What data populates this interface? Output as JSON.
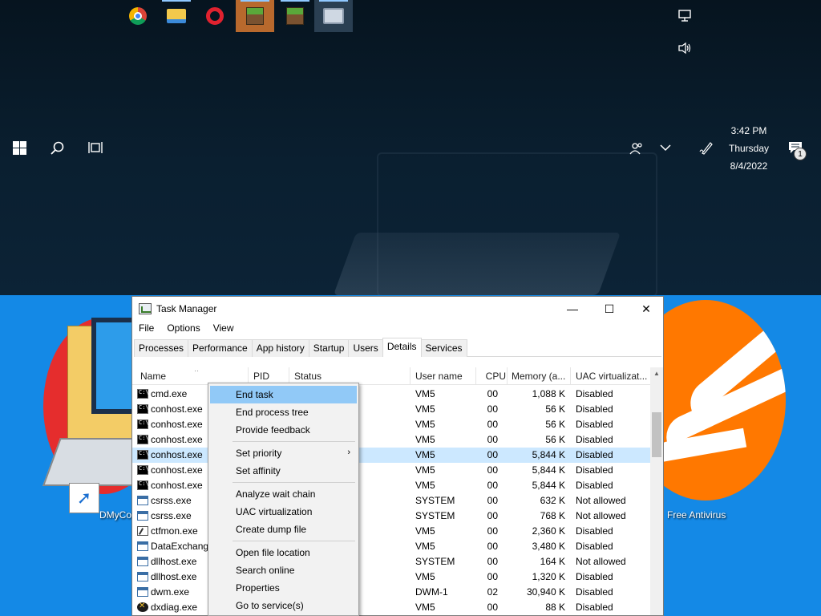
{
  "taskbar": {
    "apps": [
      {
        "name": "chrome-icon",
        "label": "Google Chrome"
      },
      {
        "name": "file-explorer-icon",
        "label": "File Explorer"
      },
      {
        "name": "opera-icon",
        "label": "Opera"
      },
      {
        "name": "minecraft-icon",
        "label": "Minecraft"
      },
      {
        "name": "minecraft-icon-2",
        "label": "Minecraft"
      },
      {
        "name": "dxdiag-window-icon",
        "label": "DirectX Diagnostic Tool"
      }
    ],
    "clock": {
      "time": "3:42 PM",
      "day": "Thursday",
      "date": "8/4/2022"
    },
    "notification_count": "1",
    "icons": {
      "start": "windows-start-icon",
      "search": "search-icon",
      "task_view": "task-view-icon",
      "people": "people-icon",
      "show_hidden": "chevron-down-icon",
      "pen": "pen-icon",
      "network": "network-icon",
      "volume": "volume-icon",
      "action_center": "action-center-icon"
    }
  },
  "desktop": {
    "left_icon_label": "DMyCo",
    "right_icon_label": "Free Antivirus"
  },
  "task_manager": {
    "title": "Task Manager",
    "window_controls": {
      "minimize": "—",
      "maximize": "☐",
      "close": "✕"
    },
    "menu": [
      "File",
      "Options",
      "View"
    ],
    "tabs": [
      "Processes",
      "Performance",
      "App history",
      "Startup",
      "Users",
      "Details",
      "Services"
    ],
    "active_tab": "Details",
    "columns": {
      "name": "Name",
      "pid": "PID",
      "status": "Status",
      "user": "User name",
      "cpu": "CPU",
      "memory": "Memory (a...",
      "uac": "UAC virtualizat..."
    },
    "rows": [
      {
        "icon": "console",
        "name": "cmd.exe",
        "user": "VM5",
        "cpu": "00",
        "memory": "1,088 K",
        "uac": "Disabled"
      },
      {
        "icon": "console",
        "name": "conhost.exe",
        "user": "VM5",
        "cpu": "00",
        "memory": "56 K",
        "uac": "Disabled"
      },
      {
        "icon": "console",
        "name": "conhost.exe",
        "user": "VM5",
        "cpu": "00",
        "memory": "56 K",
        "uac": "Disabled"
      },
      {
        "icon": "console",
        "name": "conhost.exe",
        "user": "VM5",
        "cpu": "00",
        "memory": "56 K",
        "uac": "Disabled"
      },
      {
        "icon": "console",
        "name": "conhost.exe",
        "user": "VM5",
        "cpu": "00",
        "memory": "5,844 K",
        "uac": "Disabled",
        "selected": true
      },
      {
        "icon": "console",
        "name": "conhost.exe",
        "user": "VM5",
        "cpu": "00",
        "memory": "5,844 K",
        "uac": "Disabled"
      },
      {
        "icon": "console",
        "name": "conhost.exe",
        "user": "VM5",
        "cpu": "00",
        "memory": "5,844 K",
        "uac": "Disabled"
      },
      {
        "icon": "window",
        "name": "csrss.exe",
        "user": "SYSTEM",
        "cpu": "00",
        "memory": "632 K",
        "uac": "Not allowed"
      },
      {
        "icon": "window",
        "name": "csrss.exe",
        "user": "SYSTEM",
        "cpu": "00",
        "memory": "768 K",
        "uac": "Not allowed"
      },
      {
        "icon": "pen",
        "name": "ctfmon.exe",
        "user": "VM5",
        "cpu": "00",
        "memory": "2,360 K",
        "uac": "Disabled"
      },
      {
        "icon": "window",
        "name": "DataExchange",
        "user": "VM5",
        "cpu": "00",
        "memory": "3,480 K",
        "uac": "Disabled"
      },
      {
        "icon": "window",
        "name": "dllhost.exe",
        "user": "SYSTEM",
        "cpu": "00",
        "memory": "164 K",
        "uac": "Not allowed"
      },
      {
        "icon": "window",
        "name": "dllhost.exe",
        "user": "VM5",
        "cpu": "00",
        "memory": "1,320 K",
        "uac": "Disabled"
      },
      {
        "icon": "window",
        "name": "dwm.exe",
        "user": "DWM-1",
        "cpu": "02",
        "memory": "30,940 K",
        "uac": "Disabled"
      },
      {
        "icon": "x",
        "name": "dxdiag.exe",
        "user": "VM5",
        "cpu": "00",
        "memory": "88 K",
        "uac": "Disabled"
      }
    ]
  },
  "context_menu": {
    "groups": [
      [
        {
          "label": "End task",
          "hover": true
        },
        {
          "label": "End process tree"
        },
        {
          "label": "Provide feedback"
        }
      ],
      [
        {
          "label": "Set priority",
          "submenu": true
        },
        {
          "label": "Set affinity"
        }
      ],
      [
        {
          "label": "Analyze wait chain"
        },
        {
          "label": "UAC virtualization"
        },
        {
          "label": "Create dump file"
        }
      ],
      [
        {
          "label": "Open file location"
        },
        {
          "label": "Search online"
        },
        {
          "label": "Properties"
        },
        {
          "label": "Go to service(s)"
        }
      ]
    ],
    "submenu_arrow": "›"
  },
  "colors": {
    "desktop_bg": "#1489e6",
    "selection": "#cce8ff",
    "menu_hover": "#91c9f7",
    "avast_orange": "#ff7800"
  }
}
